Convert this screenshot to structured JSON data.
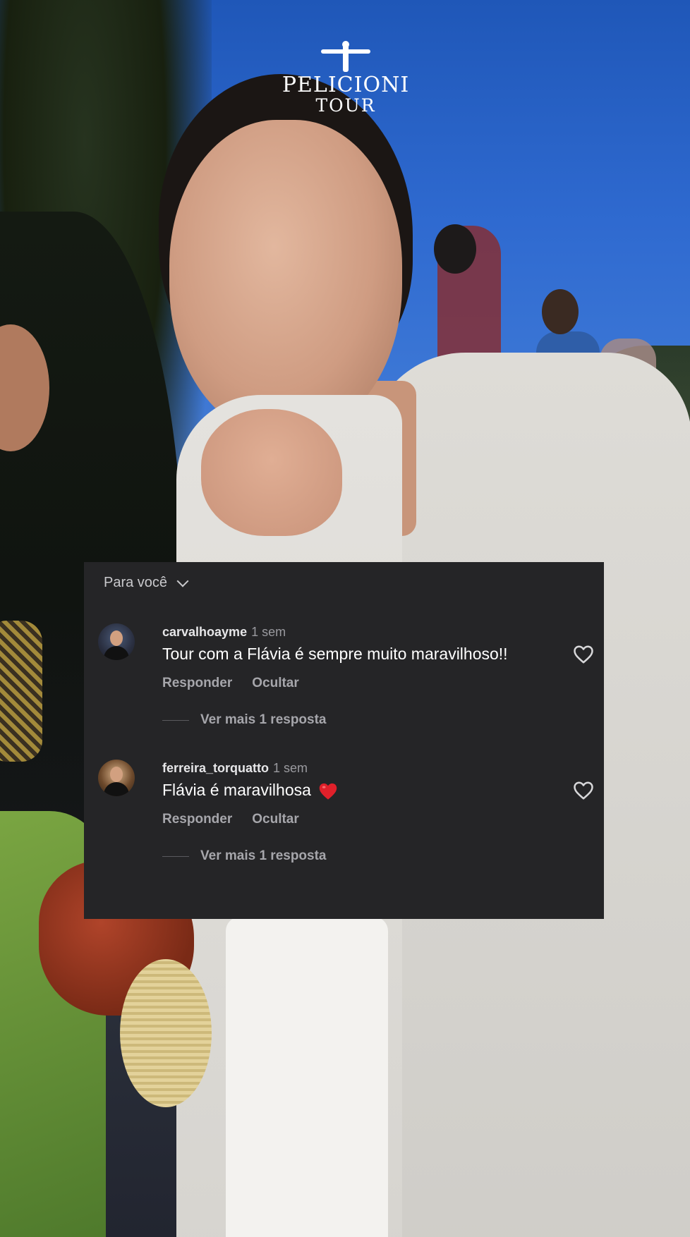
{
  "logo": {
    "name": "PELICIONI",
    "subtitle": "TOUR"
  },
  "comments_panel": {
    "filter_label": "Para você",
    "comments": [
      {
        "username": "carvalhoayme",
        "time": "1 sem",
        "text": "Tour com a Flávia é sempre muito maravilhoso!!",
        "reply_label": "Responder",
        "hide_label": "Ocultar",
        "more_replies": "Ver mais 1 resposta",
        "avatar": "user-avatar",
        "like_icon": "heart-outline-icon"
      },
      {
        "username": "ferreira_torquatto",
        "time": "1 sem",
        "text": "Flávia é maravilhosa",
        "emoji": "red-heart-emoji",
        "reply_label": "Responder",
        "hide_label": "Ocultar",
        "more_replies": "Ver mais 1 resposta",
        "avatar": "user-avatar",
        "like_icon": "heart-outline-icon"
      }
    ]
  },
  "colors": {
    "panel_bg": "#252527",
    "emoji_heart": "#e0202a"
  }
}
